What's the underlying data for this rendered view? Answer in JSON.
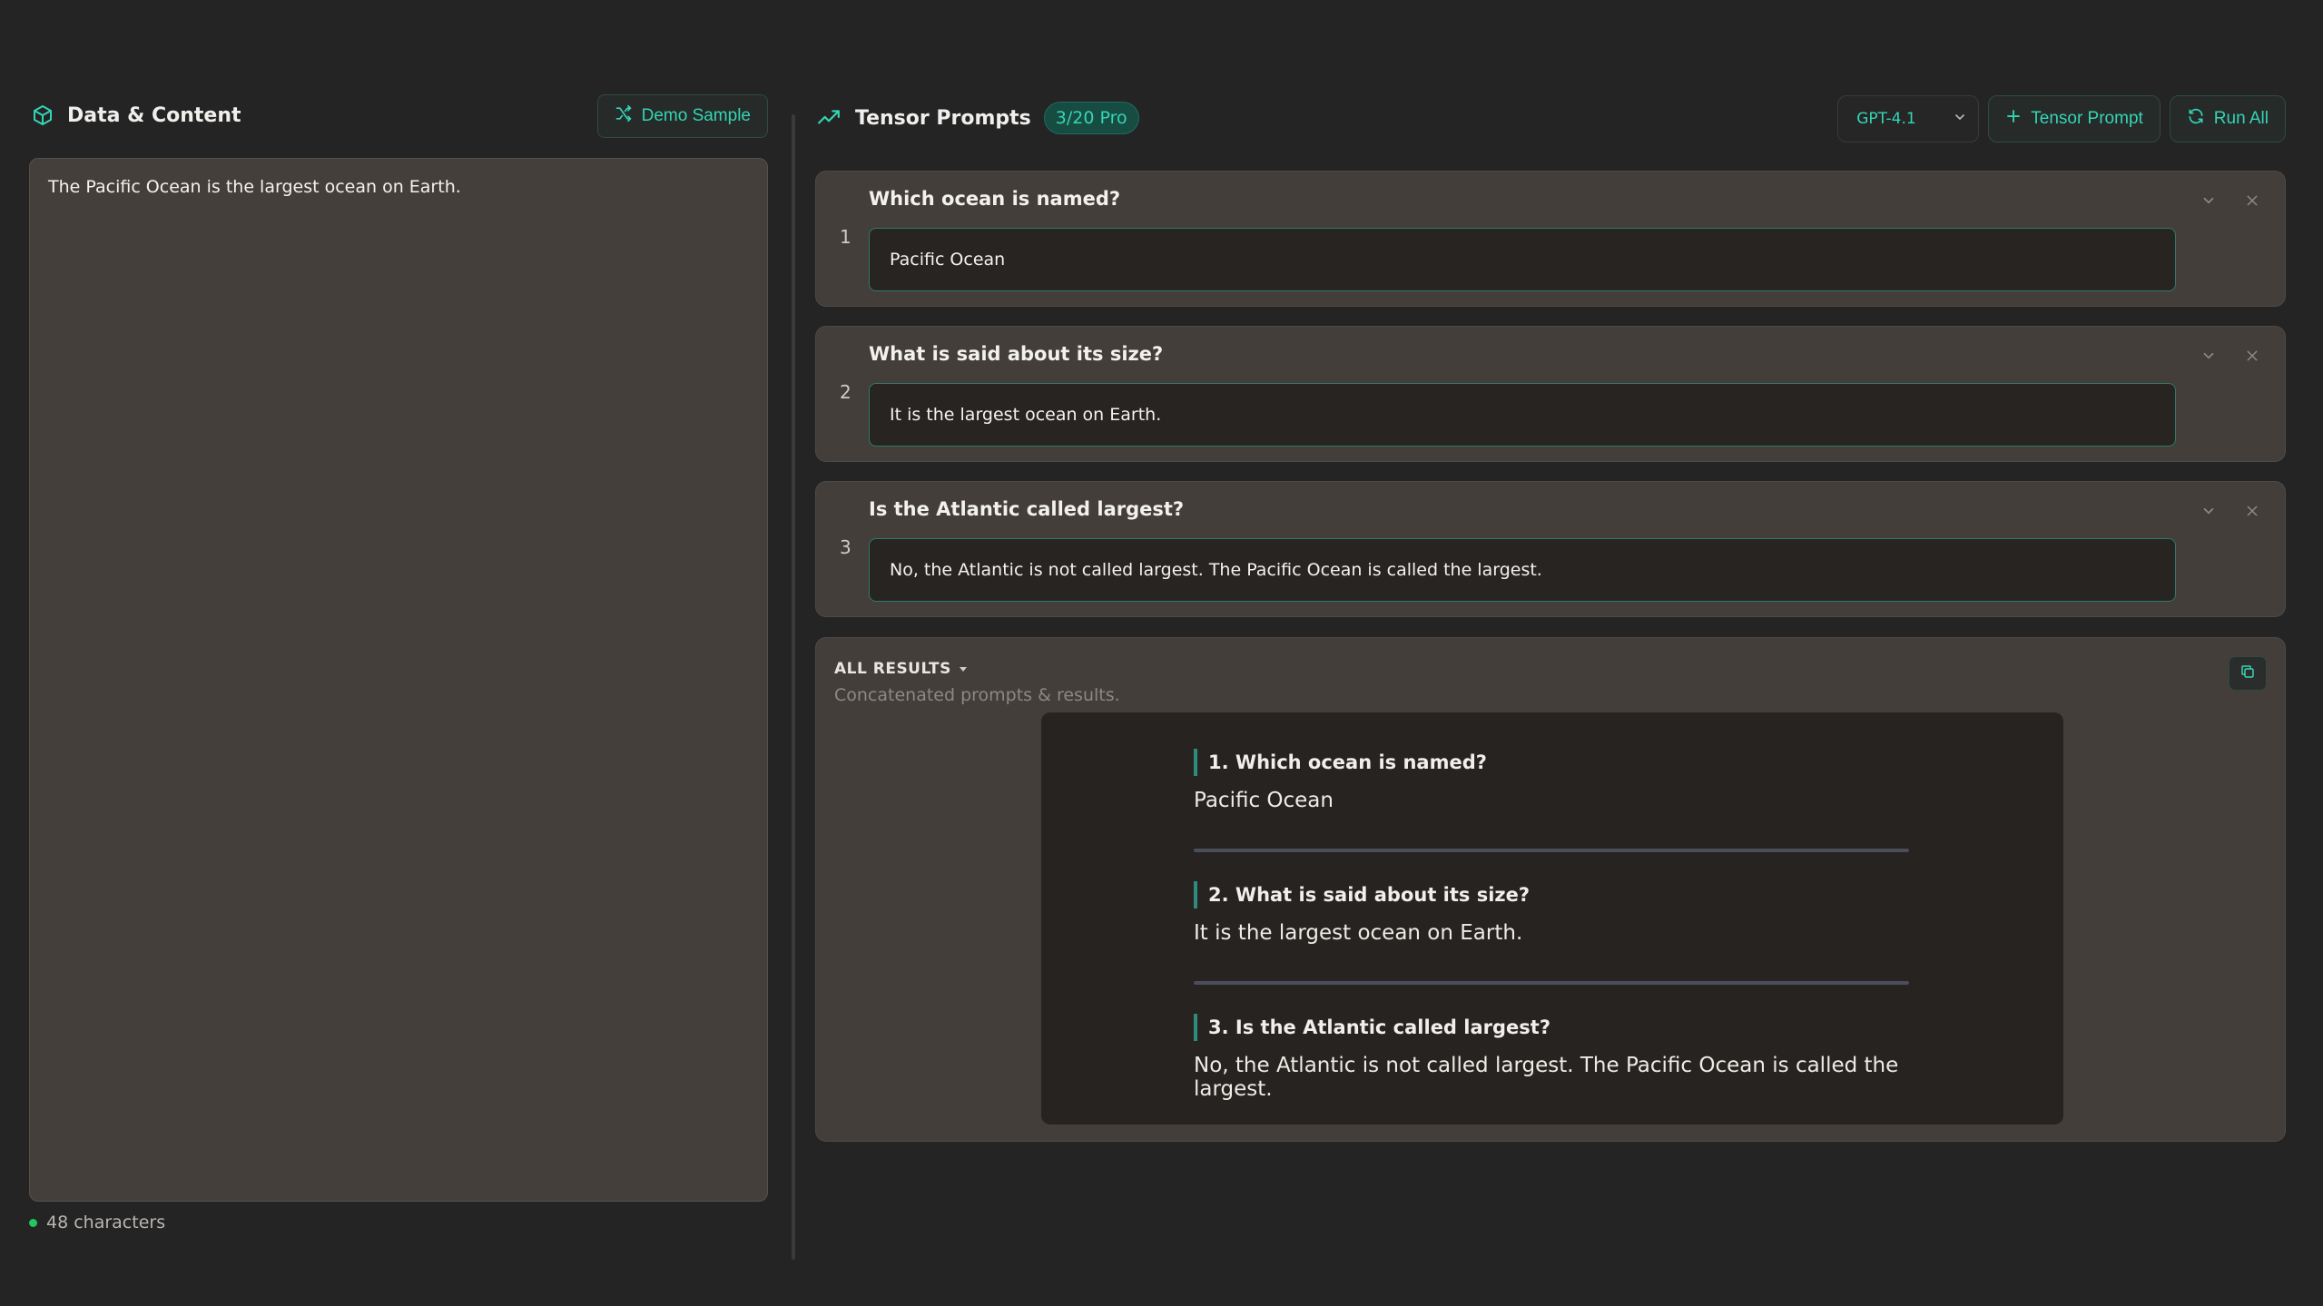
{
  "left_panel": {
    "title": "Data & Content",
    "demo_button": "Demo Sample",
    "content_text": "The Pacific Ocean is the largest ocean on Earth.",
    "char_count": "48 characters"
  },
  "right_panel": {
    "title": "Tensor Prompts",
    "badge": "3/20 Pro",
    "model_select": {
      "selected": "GPT-4.1"
    },
    "add_prompt_button": "Tensor Prompt",
    "run_all_button": "Run All",
    "prompts": [
      {
        "number": "1",
        "question": "Which ocean is named?",
        "answer": "Pacific Ocean"
      },
      {
        "number": "2",
        "question": "What is said about its size?",
        "answer": "It is the largest ocean on Earth."
      },
      {
        "number": "3",
        "question": "Is the Atlantic called largest?",
        "answer": "No, the Atlantic is not called largest. The Pacific Ocean is called the largest."
      }
    ],
    "results": {
      "label": "ALL RESULTS",
      "subtitle": "Concatenated prompts & results.",
      "items": [
        {
          "question": "1. Which ocean is named?",
          "answer": "Pacific Ocean"
        },
        {
          "question": "2. What is said about its size?",
          "answer": "It is the largest ocean on Earth."
        },
        {
          "question": "3. Is the Atlantic called largest?",
          "answer": "No, the Atlantic is not called largest. The Pacific Ocean is called the largest."
        }
      ]
    }
  },
  "colors": {
    "accent": "#34d5b5",
    "status_dot": "#22c55e",
    "background": "#242424"
  },
  "icons": [
    "cube-icon",
    "shuffle-icon",
    "branch-icon",
    "chevron-down-icon",
    "plus-icon",
    "refresh-icon",
    "close-icon",
    "caret-down-icon",
    "copy-icon"
  ]
}
